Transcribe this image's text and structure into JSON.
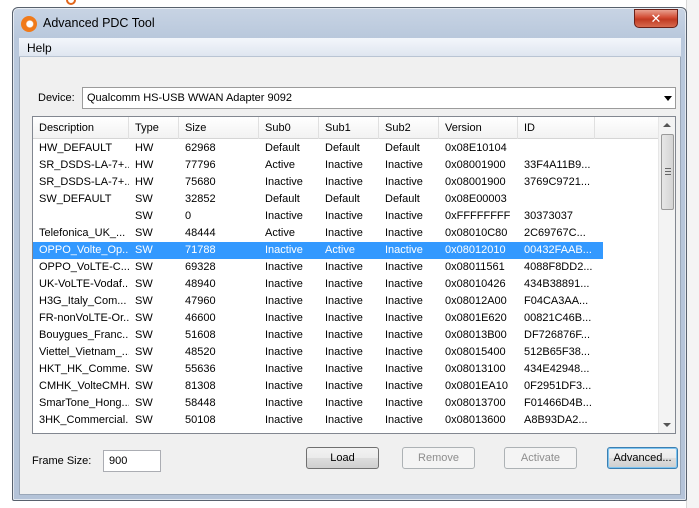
{
  "window": {
    "title": "Advanced PDC Tool",
    "close_label": "✕"
  },
  "menu": {
    "help": "Help"
  },
  "device": {
    "label": "Device:",
    "value": "Qualcomm HS-USB WWAN Adapter 9092"
  },
  "table": {
    "columns": [
      "Description",
      "Type",
      "Size",
      "Sub0",
      "Sub1",
      "Sub2",
      "Version",
      "ID"
    ],
    "selected_index": 6,
    "rows": [
      [
        "HW_DEFAULT",
        "HW",
        "62968",
        "Default",
        "Default",
        "Default",
        "0x08E10104",
        ""
      ],
      [
        "SR_DSDS-LA-7+...",
        "HW",
        "77796",
        "Active",
        "Inactive",
        "Inactive",
        "0x08001900",
        "33F4A11B9..."
      ],
      [
        "SR_DSDS-LA-7+...",
        "HW",
        "75680",
        "Inactive",
        "Inactive",
        "Inactive",
        "0x08001900",
        "3769C9721..."
      ],
      [
        "SW_DEFAULT",
        "SW",
        "32852",
        "Default",
        "Default",
        "Default",
        "0x08E00003",
        ""
      ],
      [
        "",
        "SW",
        "0",
        "Inactive",
        "Inactive",
        "Inactive",
        "0xFFFFFFFF",
        "30373037"
      ],
      [
        "Telefonica_UK_...",
        "SW",
        "48444",
        "Active",
        "Inactive",
        "Inactive",
        "0x08010C80",
        "2C69767C..."
      ],
      [
        "OPPO_Volte_Op...",
        "SW",
        "71788",
        "Inactive",
        "Active",
        "Inactive",
        "0x08012010",
        "00432FAAB..."
      ],
      [
        "OPPO_VoLTE-C...",
        "SW",
        "69328",
        "Inactive",
        "Inactive",
        "Inactive",
        "0x08011561",
        "4088F8DD2..."
      ],
      [
        "UK-VoLTE-Vodaf...",
        "SW",
        "48940",
        "Inactive",
        "Inactive",
        "Inactive",
        "0x08010426",
        "434B38891..."
      ],
      [
        "H3G_Italy_Com...",
        "SW",
        "47960",
        "Inactive",
        "Inactive",
        "Inactive",
        "0x08012A00",
        "F04CA3AA..."
      ],
      [
        "FR-nonVoLTE-Or...",
        "SW",
        "46600",
        "Inactive",
        "Inactive",
        "Inactive",
        "0x0801E620",
        "00821C46B..."
      ],
      [
        "Bouygues_Franc...",
        "SW",
        "51608",
        "Inactive",
        "Inactive",
        "Inactive",
        "0x08013B00",
        "DF726876F..."
      ],
      [
        "Viettel_Vietnam_...",
        "SW",
        "48520",
        "Inactive",
        "Inactive",
        "Inactive",
        "0x08015400",
        "512B65F38..."
      ],
      [
        "HKT_HK_Comme...",
        "SW",
        "55636",
        "Inactive",
        "Inactive",
        "Inactive",
        "0x08013100",
        "434E42948..."
      ],
      [
        "CMHK_VolteCMH...",
        "SW",
        "81308",
        "Inactive",
        "Inactive",
        "Inactive",
        "0x0801EA10",
        "0F2951DF3..."
      ],
      [
        "SmarTone_Hong...",
        "SW",
        "58448",
        "Inactive",
        "Inactive",
        "Inactive",
        "0x08013700",
        "F01466D4B..."
      ],
      [
        "3HK_Commercial...",
        "SW",
        "50108",
        "Inactive",
        "Inactive",
        "Inactive",
        "0x08013600",
        "A8B93DA2..."
      ]
    ]
  },
  "frame": {
    "label": "Frame Size:",
    "value": "900"
  },
  "buttons": {
    "load": "Load",
    "remove": "Remove",
    "activate": "Activate",
    "advanced": "Advanced..."
  }
}
